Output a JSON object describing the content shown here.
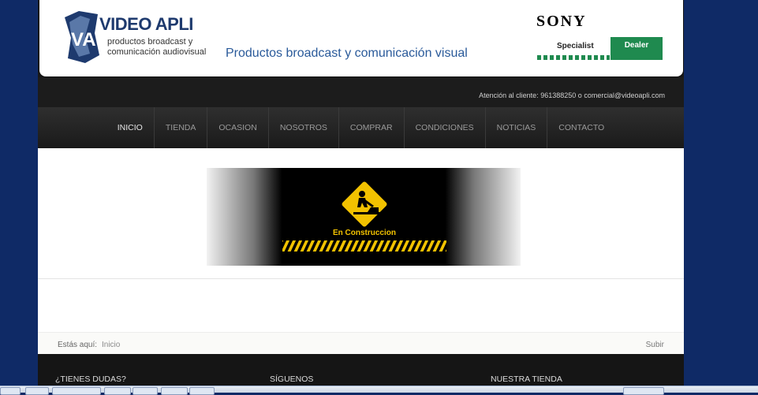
{
  "header": {
    "logo_title": "VIDEO APLI",
    "logo_sub1": "productos broadcast y",
    "logo_sub2": "comunicación audiovisual",
    "tagline": "Productos broadcast y comunicación visual",
    "sony": "SONY",
    "specialist": "Specialist",
    "dealer": "Dealer"
  },
  "topbar": {
    "contact_prefix": "Atención al cliente:",
    "phone": "961388250",
    "contact_mid": "o",
    "email": "comercial@videoapli.com"
  },
  "nav": {
    "items": [
      "INICIO",
      "TIENDA",
      "OCASION",
      "NOSOTROS",
      "COMPRAR",
      "CONDICIONES",
      "NOTICIAS",
      "CONTACTO"
    ]
  },
  "banner": {
    "text": "En Construccion"
  },
  "breadcrumb": {
    "label": "Estás aquí:",
    "home": "Inicio",
    "up": "Subir"
  },
  "footer": {
    "col1": "¿TIENES DUDAS?",
    "col2": "SÍGUENOS",
    "col3": "NUESTRA TIENDA"
  },
  "colors": {
    "page_bg": "#0f2a66",
    "brand_blue": "#1e3a6e",
    "dealer_green": "#1f8a4f",
    "warning_yellow": "#f2c200"
  }
}
